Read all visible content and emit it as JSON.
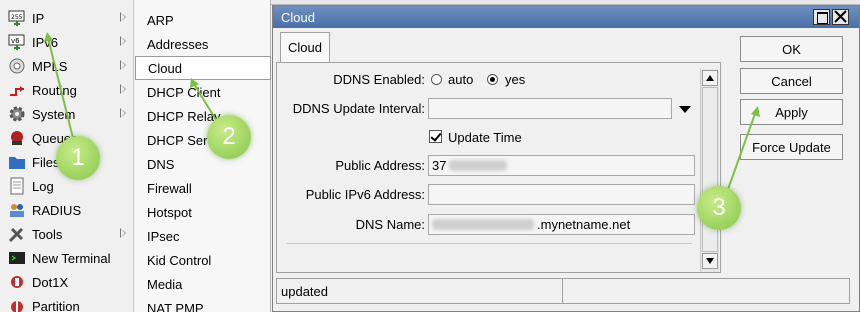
{
  "menu": {
    "items": [
      {
        "label": "IP",
        "icon": "ip-icon",
        "submenu": true
      },
      {
        "label": "IPv6",
        "icon": "ipv6-icon",
        "submenu": true
      },
      {
        "label": "MPLS",
        "icon": "mpls-icon",
        "submenu": true
      },
      {
        "label": "Routing",
        "icon": "routing-icon",
        "submenu": true
      },
      {
        "label": "System",
        "icon": "gear-icon",
        "submenu": true
      },
      {
        "label": "Queues",
        "icon": "queues-icon",
        "submenu": false
      },
      {
        "label": "Files",
        "icon": "folder-icon",
        "submenu": false
      },
      {
        "label": "Log",
        "icon": "log-icon",
        "submenu": false
      },
      {
        "label": "RADIUS",
        "icon": "radius-icon",
        "submenu": false
      },
      {
        "label": "Tools",
        "icon": "tools-icon",
        "submenu": true
      },
      {
        "label": "New Terminal",
        "icon": "terminal-icon",
        "submenu": false
      },
      {
        "label": "Dot1X",
        "icon": "dot1x-icon",
        "submenu": false
      },
      {
        "label": "Partition",
        "icon": "partition-icon",
        "submenu": false
      }
    ]
  },
  "submenu": {
    "items": [
      "ARP",
      "Addresses",
      "Cloud",
      "DHCP Client",
      "DHCP Relay",
      "DHCP Server",
      "DNS",
      "Firewall",
      "Hotspot",
      "IPsec",
      "Kid Control",
      "Media",
      "NAT PMP"
    ],
    "selected": "Cloud"
  },
  "dialog": {
    "title": "Cloud",
    "tab": "Cloud",
    "ddns_enabled_label": "DDNS Enabled:",
    "ddns_enabled_options": [
      "auto",
      "yes"
    ],
    "ddns_enabled_value": "yes",
    "ddns_interval_label": "DDNS Update Interval:",
    "ddns_interval_value": "",
    "update_time_label": "Update Time",
    "update_time_checked": true,
    "public_address_label": "Public Address:",
    "public_address_value": "37",
    "public_ipv6_label": "Public IPv6 Address:",
    "public_ipv6_value": "",
    "dns_name_label": "DNS Name:",
    "dns_name_suffix": ".mynetname.net",
    "buttons": {
      "ok": "OK",
      "cancel": "Cancel",
      "apply": "Apply",
      "force_update": "Force Update"
    },
    "status": "updated"
  },
  "annotations": [
    "1",
    "2",
    "3"
  ],
  "colors": {
    "callout": "#86c648",
    "titlebar": "#4a6fa8"
  }
}
